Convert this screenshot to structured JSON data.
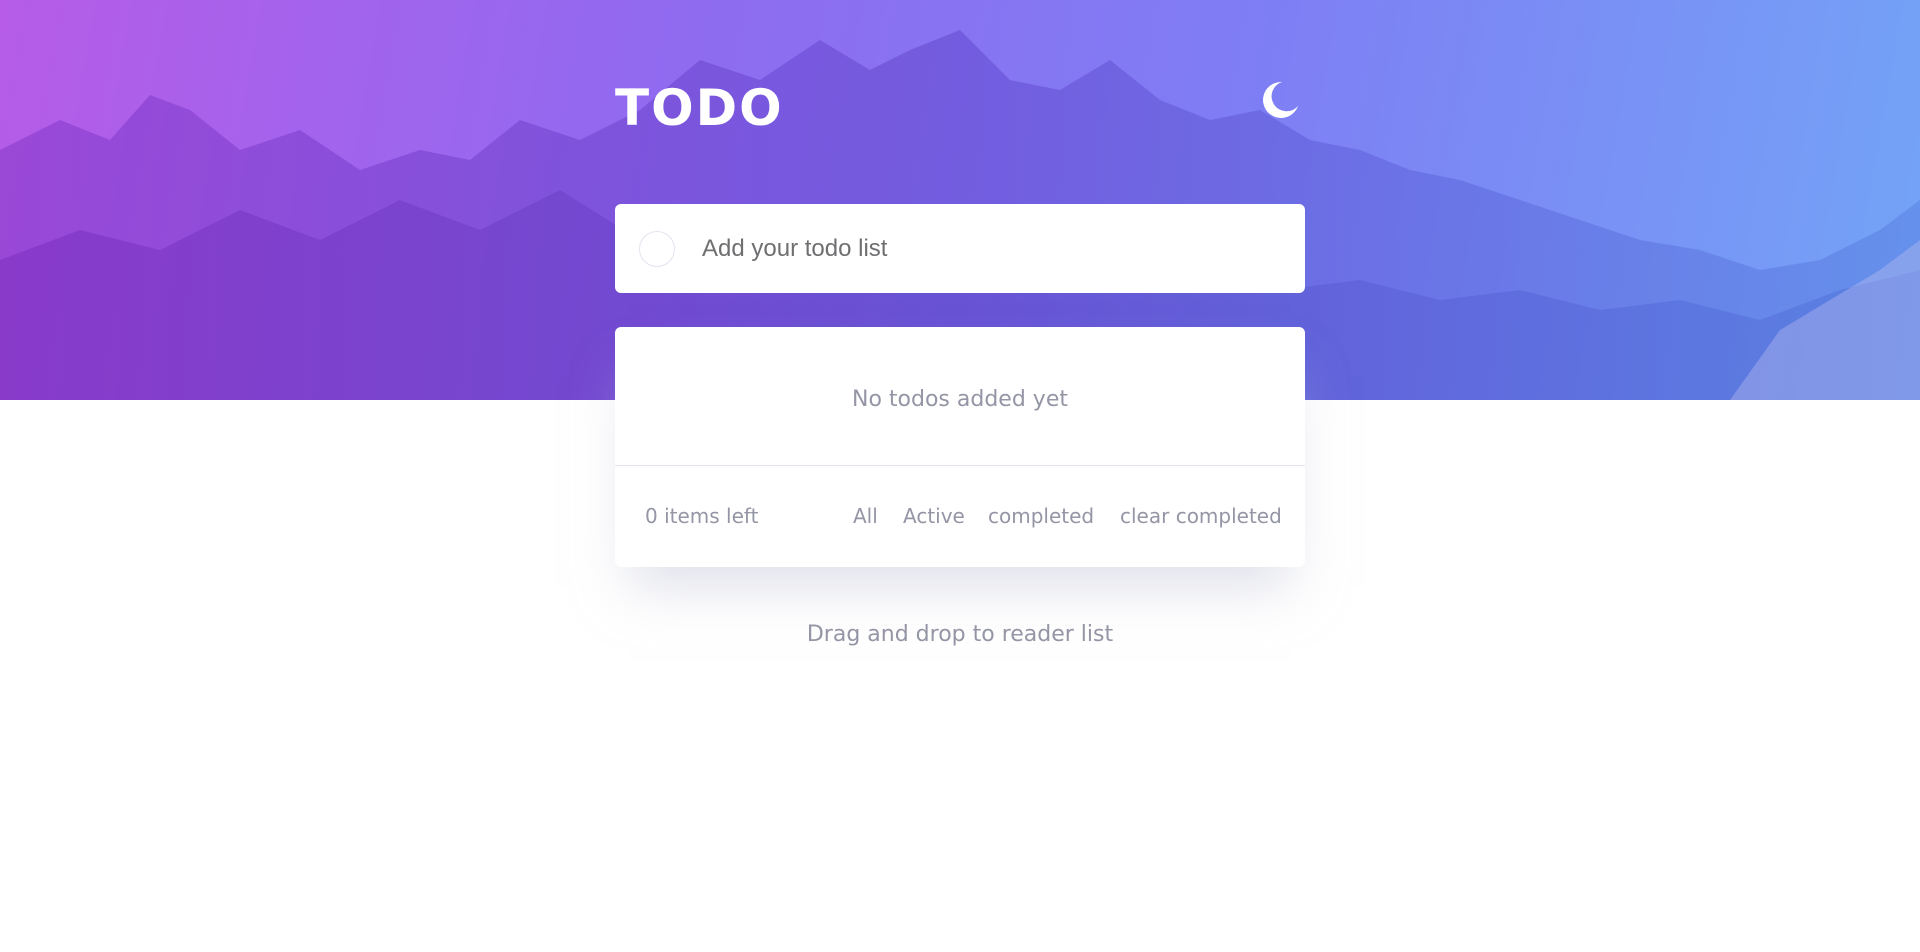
{
  "header": {
    "title": "TODO",
    "theme_toggle_icon": "moon-icon"
  },
  "new_todo": {
    "placeholder": "Add your todo list",
    "value": ""
  },
  "list": {
    "empty_message": "No todos added yet",
    "items": []
  },
  "footer": {
    "items_left": "0 items left",
    "filters": [
      "All",
      "Active",
      "completed"
    ],
    "clear_completed": "clear completed"
  },
  "hint": "Drag and drop to reader list",
  "colors": {
    "gradient_start": "#b65ce8",
    "gradient_end": "#73a4f6",
    "text_muted": "#9495a5",
    "card_bg": "#ffffff",
    "page_bg": "#ffffff"
  }
}
